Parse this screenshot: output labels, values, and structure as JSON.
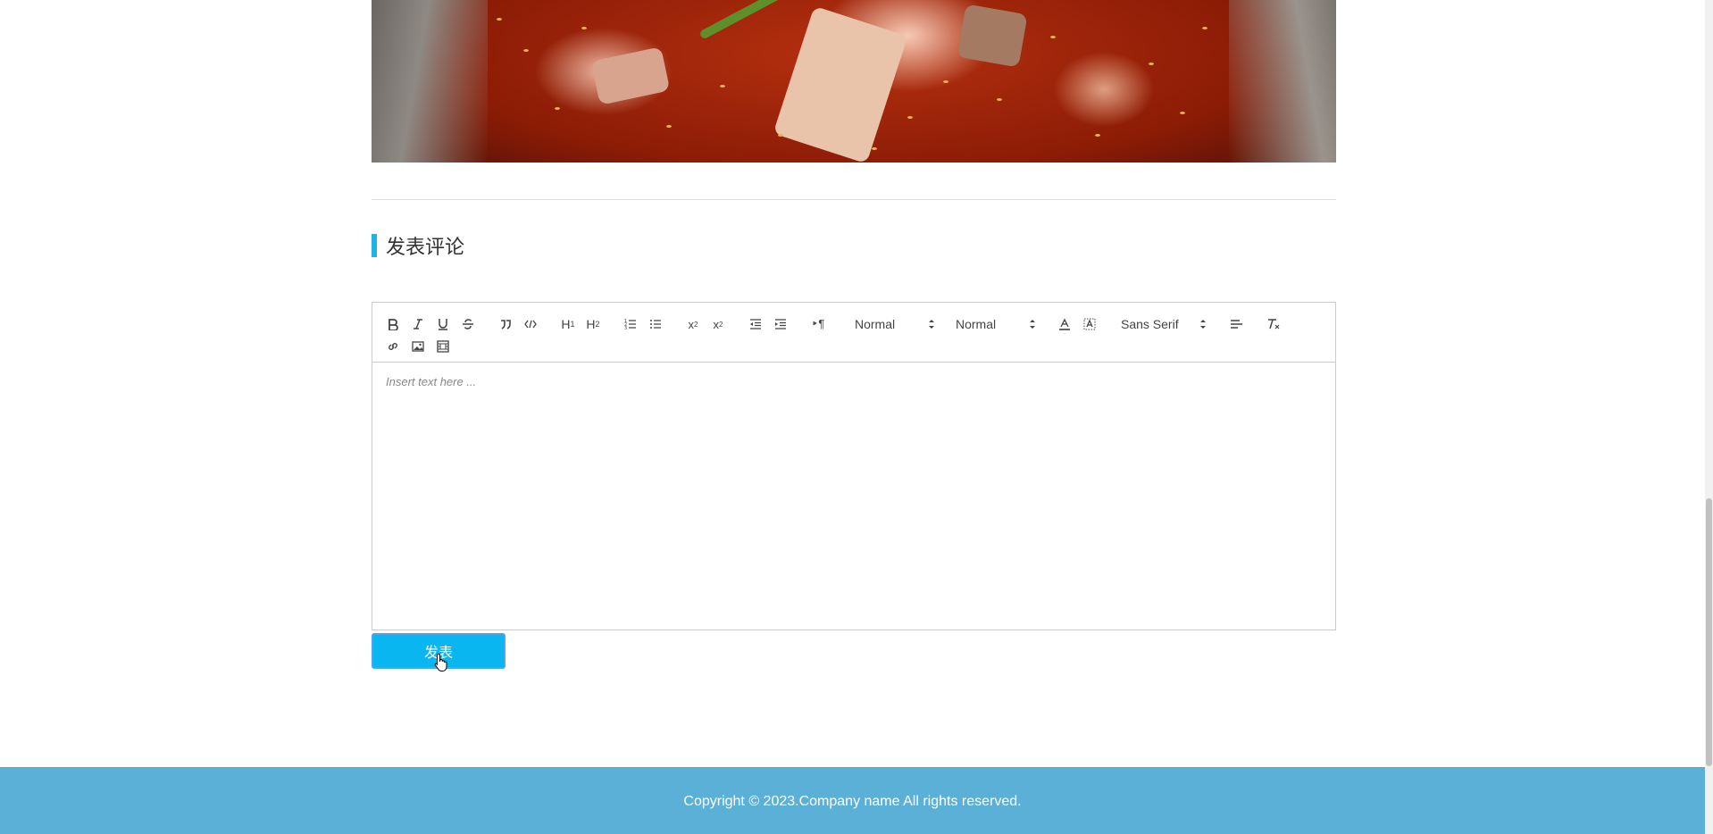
{
  "section": {
    "title": "发表评论"
  },
  "editor": {
    "placeholder": "Insert text here ...",
    "header_picker_value": "Normal",
    "size_picker_value": "Normal",
    "font_picker_value": "Sans Serif",
    "toolbar_icons": [
      "bold-icon",
      "italic-icon",
      "underline-icon",
      "strike-icon",
      "blockquote-icon",
      "code-block-icon",
      "header-1-icon",
      "header-2-icon",
      "ordered-list-icon",
      "bullet-list-icon",
      "subscript-icon",
      "superscript-icon",
      "outdent-icon",
      "indent-icon",
      "direction-rtl-icon",
      "text-color-icon",
      "background-color-icon",
      "align-icon",
      "clean-format-icon",
      "link-icon",
      "image-icon",
      "video-icon"
    ]
  },
  "submit": {
    "label": "发表"
  },
  "footer": {
    "copyright": "Copyright © 2023.Company name All rights reserved."
  },
  "colors": {
    "accent": "#0ab6ef",
    "footer_bg": "#5ab0d6",
    "title_bar": "#1fb3e6"
  }
}
